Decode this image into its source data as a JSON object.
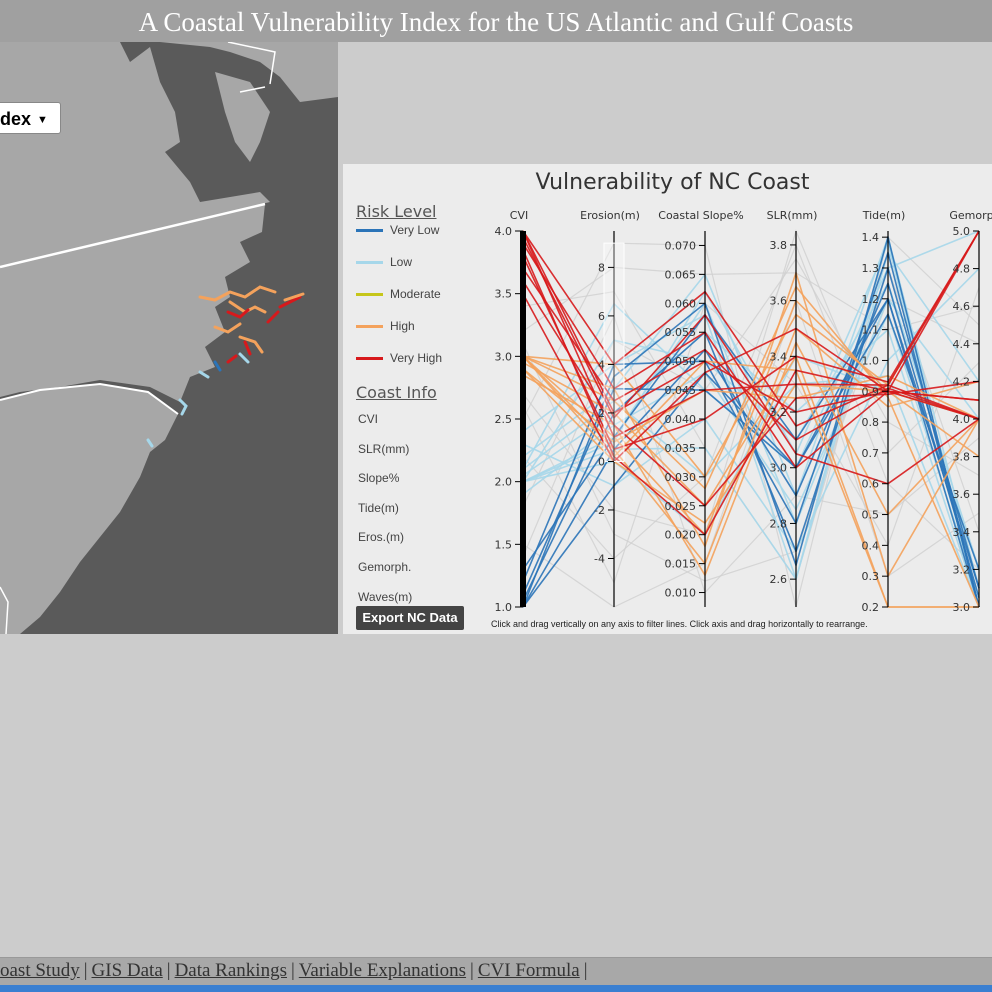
{
  "page": {
    "title": "A Coastal Vulnerability Index for the US Atlantic and Gulf Coasts"
  },
  "map": {
    "selector_label": "dex",
    "selector_icon": "caret-down-icon",
    "colors": {
      "water": "#5a5a5a",
      "land": "#a7a7a7",
      "state_border": "#ffffff"
    }
  },
  "panel": {
    "title": "Vulnerability of NC Coast",
    "legend_title": "Risk Level",
    "legend": [
      {
        "label": "Very Low",
        "color": "#2b74b8"
      },
      {
        "label": "Low",
        "color": "#a6d7ea"
      },
      {
        "label": "Moderate",
        "color": "#c6c61a"
      },
      {
        "label": "High",
        "color": "#f4a25c"
      },
      {
        "label": "Very High",
        "color": "#d7191c"
      }
    ],
    "info_title": "Coast Info",
    "info": [
      "CVI",
      "SLR(mm)",
      "Slope%",
      "Tide(m)",
      "Eros.(m)",
      "Gemorph.",
      "Waves(m)"
    ],
    "export_label": "Export NC Data",
    "hint": "Click and drag vertically on any axis to filter lines. Click axis and drag horizontally to rearrange."
  },
  "chart_data": {
    "type": "parallel-coordinates",
    "axes": [
      {
        "name": "CVI",
        "ticks": [
          "1.0",
          "1.5",
          "2.0",
          "2.5",
          "3.0",
          "3.5",
          "4.0"
        ],
        "range": [
          1.0,
          4.0
        ]
      },
      {
        "name": "Erosion(m)",
        "ticks": [
          "-4",
          "-2",
          "0",
          "2",
          "4",
          "6",
          "8"
        ],
        "range": [
          -6,
          9.5
        ],
        "brush": [
          0,
          9
        ]
      },
      {
        "name": "Coastal Slope%",
        "ticks": [
          "0.010",
          "0.015",
          "0.020",
          "0.025",
          "0.030",
          "0.035",
          "0.040",
          "0.045",
          "0.050",
          "0.055",
          "0.060",
          "0.065",
          "0.070"
        ],
        "range": [
          0.0075,
          0.0725
        ]
      },
      {
        "name": "SLR(mm)",
        "ticks": [
          "2.6",
          "2.8",
          "3.0",
          "3.2",
          "3.4",
          "3.6",
          "3.8"
        ],
        "range": [
          2.5,
          3.85
        ]
      },
      {
        "name": "Tide(m)",
        "ticks": [
          "0.2",
          "0.3",
          "0.4",
          "0.5",
          "0.6",
          "0.7",
          "0.8",
          "0.9",
          "1.0",
          "1.1",
          "1.2",
          "1.3",
          "1.4"
        ],
        "range": [
          0.2,
          1.42
        ]
      },
      {
        "name": "Gemorph",
        "ticks": [
          "3.0",
          "3.2",
          "3.4",
          "3.6",
          "3.8",
          "4.0",
          "4.2",
          "4.4",
          "4.6",
          "4.8",
          "5.0"
        ],
        "range": [
          3.0,
          5.0
        ]
      }
    ],
    "series": [
      {
        "name": "Very Low",
        "color": "#2b74b8",
        "lines": [
          [
            1.0,
            -1,
            0.048,
            3.0,
            1.2,
            3.0
          ],
          [
            1.0,
            0.5,
            0.052,
            2.9,
            1.25,
            3.05
          ],
          [
            1.05,
            2,
            0.055,
            2.7,
            1.3,
            3.1
          ],
          [
            1.1,
            3,
            0.045,
            3.0,
            1.15,
            3.2
          ],
          [
            1.2,
            4,
            0.05,
            2.8,
            1.35,
            3.0
          ],
          [
            1.3,
            1,
            0.058,
            3.1,
            1.2,
            3.1
          ],
          [
            1.0,
            3.5,
            0.06,
            2.65,
            1.4,
            3.0
          ]
        ]
      },
      {
        "name": "Low",
        "color": "#a6d7ea",
        "lines": [
          [
            2.0,
            0.5,
            0.035,
            2.6,
            1.4,
            3.0
          ],
          [
            2.0,
            1,
            0.06,
            2.8,
            1.2,
            4.0
          ],
          [
            2.05,
            2,
            0.055,
            3.2,
            1.1,
            3.0
          ],
          [
            2.1,
            6.5,
            0.045,
            3.0,
            1.3,
            5.0
          ],
          [
            2.0,
            0,
            0.02,
            3.4,
            0.9,
            4.0
          ],
          [
            2.2,
            3,
            0.065,
            2.9,
            1.4,
            3.1
          ],
          [
            2.3,
            -1,
            0.04,
            2.7,
            1.0,
            4.8
          ],
          [
            2.0,
            5,
            0.05,
            3.1,
            1.25,
            3.2
          ],
          [
            2.1,
            2.5,
            0.03,
            3.3,
            0.95,
            3.0
          ],
          [
            2.4,
            4,
            0.058,
            2.6,
            1.35,
            4.2
          ],
          [
            1.9,
            1.5,
            0.048,
            2.85,
            1.15,
            3.05
          ],
          [
            2.0,
            0.8,
            0.062,
            3.05,
            1.38,
            3.0
          ]
        ]
      },
      {
        "name": "High",
        "color": "#f4a25c",
        "lines": [
          [
            3.0,
            1,
            0.02,
            3.6,
            0.9,
            4.0
          ],
          [
            3.0,
            0.5,
            0.015,
            3.5,
            0.85,
            4.2
          ],
          [
            2.95,
            2,
            0.025,
            3.4,
            0.2,
            3.0
          ],
          [
            3.0,
            3,
            0.018,
            3.7,
            0.3,
            4.0
          ],
          [
            2.9,
            0,
            0.022,
            3.3,
            0.9,
            3.8
          ],
          [
            3.0,
            4,
            0.03,
            3.55,
            0.92,
            5.0
          ],
          [
            2.85,
            1.5,
            0.013,
            3.45,
            0.5,
            4.0
          ],
          [
            3.0,
            2.5,
            0.028,
            3.65,
            0.88,
            3.0
          ],
          [
            2.9,
            0.8,
            0.045,
            3.25,
            0.95,
            4.0
          ],
          [
            3.0,
            0.2,
            0.05,
            3.35,
            0.2,
            3.0
          ]
        ]
      },
      {
        "name": "Very High",
        "color": "#d7191c",
        "lines": [
          [
            4.0,
            2,
            0.05,
            3.2,
            0.9,
            4.0
          ],
          [
            4.0,
            1,
            0.045,
            3.3,
            0.92,
            5.0
          ],
          [
            3.9,
            3,
            0.055,
            3.0,
            0.9,
            4.1
          ],
          [
            3.8,
            0.5,
            0.04,
            3.4,
            0.93,
            5.0
          ],
          [
            3.7,
            2.5,
            0.052,
            3.1,
            0.91,
            4.0
          ],
          [
            3.6,
            1.5,
            0.025,
            3.25,
            0.89,
            4.2
          ],
          [
            3.5,
            0,
            0.048,
            3.5,
            0.9,
            5.0
          ],
          [
            4.0,
            4,
            0.062,
            3.15,
            0.92,
            4.0
          ],
          [
            3.85,
            0.2,
            0.02,
            3.35,
            0.9,
            4.1
          ],
          [
            3.95,
            1.8,
            0.058,
            3.05,
            0.6,
            4.0
          ]
        ]
      },
      {
        "name": "",
        "color": "#cfcfcf",
        "lines": [
          [
            1.5,
            -6,
            0.015,
            3.6,
            0.3,
            3.5
          ],
          [
            2.5,
            9,
            0.07,
            2.5,
            1.4,
            4.5
          ],
          [
            2.2,
            -4,
            0.03,
            3.8,
            0.6,
            3.2
          ],
          [
            3.2,
            8,
            0.065,
            3.7,
            1.1,
            4.6
          ],
          [
            1.8,
            6,
            0.01,
            2.9,
            0.5,
            3.9
          ],
          [
            2.7,
            -2,
            0.02,
            3.85,
            0.7,
            4.3
          ],
          [
            3.4,
            7,
            0.035,
            2.6,
            1.3,
            3.4
          ],
          [
            2.6,
            -5,
            0.06,
            3.3,
            0.4,
            4.7
          ],
          [
            1.4,
            5,
            0.045,
            3.75,
            0.8,
            3.7
          ],
          [
            3.1,
            -3,
            0.012,
            2.7,
            1.2,
            4.4
          ]
        ]
      }
    ]
  },
  "footer": {
    "links": [
      "oast Study",
      "GIS Data",
      "Data Rankings",
      "Variable Explanations",
      "CVI Formula"
    ],
    "trailing_sep": "|"
  }
}
